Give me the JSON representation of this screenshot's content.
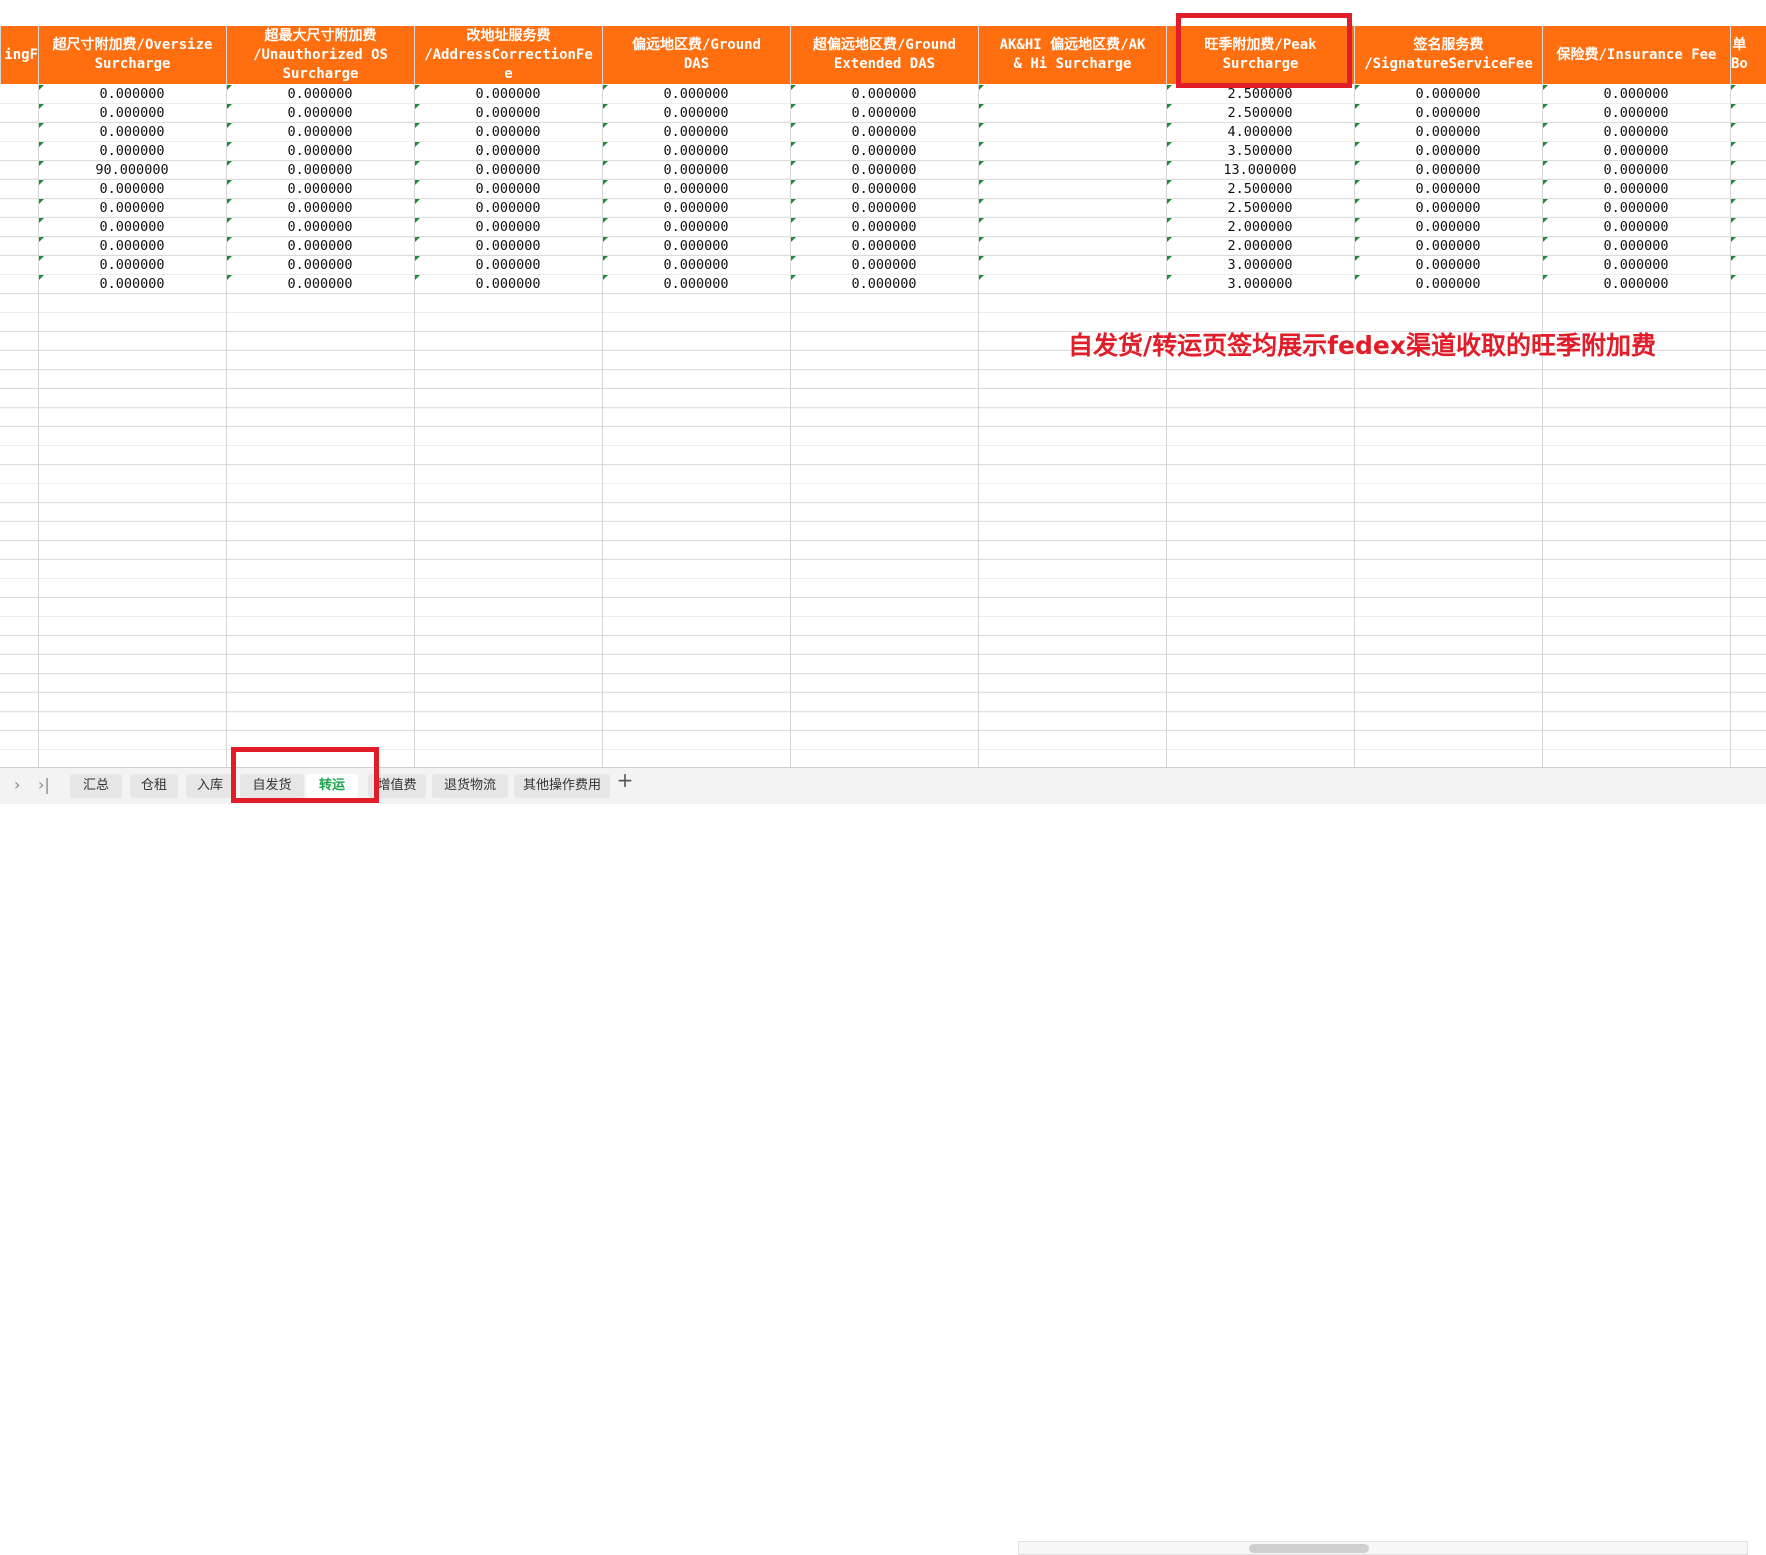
{
  "headers": [
    {
      "id": "partial",
      "label": "ingF"
    },
    {
      "id": "oversize",
      "label": "超尺寸附加费/Oversize\nSurcharge"
    },
    {
      "id": "unauth_os",
      "label": "超最大尺寸附加费\n/Unauthorized OS\nSurcharge"
    },
    {
      "id": "addr",
      "label": "改地址服务费\n/AddressCorrectionFe\ne"
    },
    {
      "id": "das",
      "label": "偏远地区费/Ground\nDAS"
    },
    {
      "id": "ext_das",
      "label": "超偏远地区费/Ground\nExtended DAS"
    },
    {
      "id": "akhi",
      "label": "AK&HI 偏远地区费/AK\n& Hi Surcharge"
    },
    {
      "id": "peak",
      "label": "旺季附加费/Peak\nSurcharge"
    },
    {
      "id": "signature",
      "label": "签名服务费\n/SignatureServiceFee"
    },
    {
      "id": "insurance",
      "label": "保险费/Insurance Fee"
    },
    {
      "id": "partial2",
      "label": "单\nBo"
    }
  ],
  "rows": [
    {
      "oversize": "0.000000",
      "unauth_os": "0.000000",
      "addr": "0.000000",
      "das": "0.000000",
      "ext_das": "0.000000",
      "peak": "2.500000",
      "signature": "0.000000",
      "insurance": "0.000000"
    },
    {
      "oversize": "0.000000",
      "unauth_os": "0.000000",
      "addr": "0.000000",
      "das": "0.000000",
      "ext_das": "0.000000",
      "peak": "2.500000",
      "signature": "0.000000",
      "insurance": "0.000000"
    },
    {
      "oversize": "0.000000",
      "unauth_os": "0.000000",
      "addr": "0.000000",
      "das": "0.000000",
      "ext_das": "0.000000",
      "peak": "4.000000",
      "signature": "0.000000",
      "insurance": "0.000000"
    },
    {
      "oversize": "0.000000",
      "unauth_os": "0.000000",
      "addr": "0.000000",
      "das": "0.000000",
      "ext_das": "0.000000",
      "peak": "3.500000",
      "signature": "0.000000",
      "insurance": "0.000000"
    },
    {
      "oversize": "90.000000",
      "unauth_os": "0.000000",
      "addr": "0.000000",
      "das": "0.000000",
      "ext_das": "0.000000",
      "peak": "13.000000",
      "signature": "0.000000",
      "insurance": "0.000000"
    },
    {
      "oversize": "0.000000",
      "unauth_os": "0.000000",
      "addr": "0.000000",
      "das": "0.000000",
      "ext_das": "0.000000",
      "peak": "2.500000",
      "signature": "0.000000",
      "insurance": "0.000000"
    },
    {
      "oversize": "0.000000",
      "unauth_os": "0.000000",
      "addr": "0.000000",
      "das": "0.000000",
      "ext_das": "0.000000",
      "peak": "2.500000",
      "signature": "0.000000",
      "insurance": "0.000000"
    },
    {
      "oversize": "0.000000",
      "unauth_os": "0.000000",
      "addr": "0.000000",
      "das": "0.000000",
      "ext_das": "0.000000",
      "peak": "2.000000",
      "signature": "0.000000",
      "insurance": "0.000000"
    },
    {
      "oversize": "0.000000",
      "unauth_os": "0.000000",
      "addr": "0.000000",
      "das": "0.000000",
      "ext_das": "0.000000",
      "peak": "2.000000",
      "signature": "0.000000",
      "insurance": "0.000000"
    },
    {
      "oversize": "0.000000",
      "unauth_os": "0.000000",
      "addr": "0.000000",
      "das": "0.000000",
      "ext_das": "0.000000",
      "peak": "3.000000",
      "signature": "0.000000",
      "insurance": "0.000000"
    },
    {
      "oversize": "0.000000",
      "unauth_os": "0.000000",
      "addr": "0.000000",
      "das": "0.000000",
      "ext_das": "0.000000",
      "peak": "3.000000",
      "signature": "0.000000",
      "insurance": "0.000000"
    }
  ],
  "annotation": "自发货/转运页签均展示fedex渠道收取的旺季附加费",
  "tabs": [
    {
      "label": "汇总",
      "active": false
    },
    {
      "label": "仓租",
      "active": false
    },
    {
      "label": "入库",
      "active": false
    },
    {
      "label": "自发货",
      "active": false
    },
    {
      "label": "转运",
      "active": true
    },
    {
      "label": "增值费",
      "active": false
    },
    {
      "label": "退货物流",
      "active": false
    },
    {
      "label": "其他操作费用",
      "active": false
    }
  ],
  "tab_nav": {
    "next": "›",
    "last": "›|"
  },
  "add_tab_label": "+",
  "colors": {
    "header_bg": "#ff6f0f",
    "highlight": "#e21d2a",
    "active_tab": "#1aa34a"
  }
}
